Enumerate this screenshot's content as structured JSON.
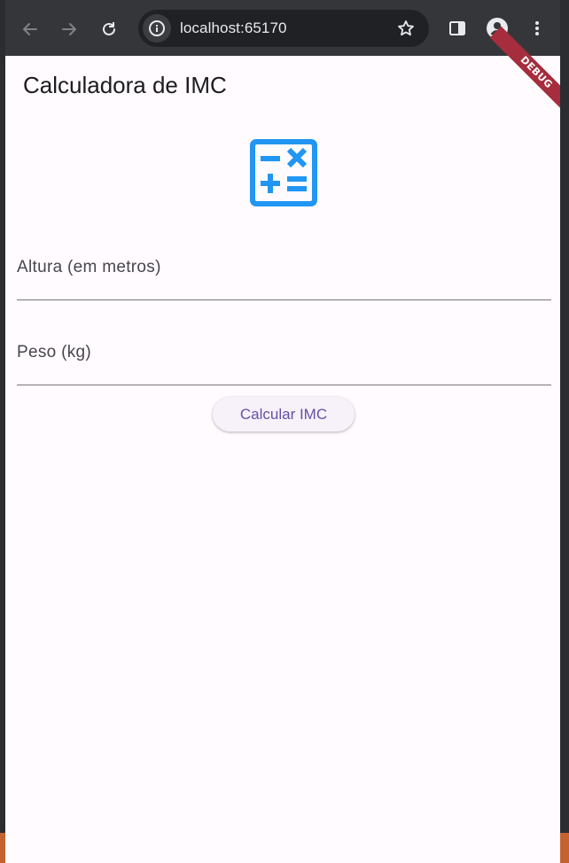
{
  "browser": {
    "url": "localhost:65170"
  },
  "app": {
    "title": "Calculadora de IMC",
    "debug_banner": "DEBUG",
    "icon": "calculate-icon",
    "accent_color": "#2196f3",
    "fields": {
      "height_label": "Altura (em metros)",
      "weight_label": "Peso (kg)"
    },
    "button_label": "Calcular IMC"
  }
}
